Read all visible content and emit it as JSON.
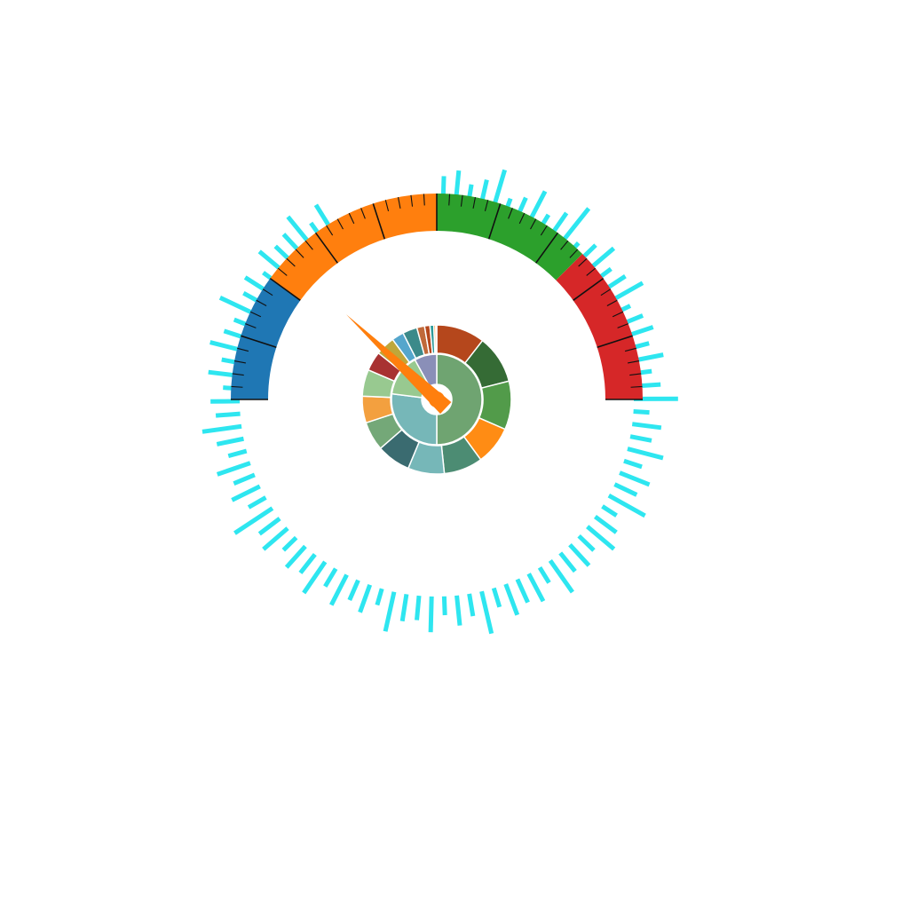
{
  "chart_data": [
    {
      "type": "gauge",
      "min": 0,
      "max": 100,
      "value": 24,
      "bands": [
        {
          "from": 0,
          "to": 20,
          "color": "#1f77b4"
        },
        {
          "from": 20,
          "to": 50,
          "color": "#ff7f0e"
        },
        {
          "from": 50,
          "to": 75,
          "color": "#2ca02c"
        },
        {
          "from": 75,
          "to": 100,
          "color": "#d62728"
        }
      ],
      "major_tick_every": 10,
      "minor_tick_every": 2,
      "needle_color": "#ff7f0e"
    },
    {
      "type": "radial-bar",
      "bar_color": "#2ee6f0",
      "start_angle_deg": 90,
      "end_angle_deg": -240,
      "values": [
        28,
        35,
        22,
        30,
        45,
        18,
        25,
        40,
        20,
        32,
        50,
        15,
        26,
        38,
        22,
        30,
        42,
        19,
        27,
        33,
        24,
        36,
        21,
        29,
        47,
        17,
        31,
        23,
        39,
        20,
        34,
        26,
        44,
        18,
        28,
        37,
        22,
        30,
        25,
        41,
        19,
        33,
        27,
        35,
        21,
        46,
        24,
        32,
        20,
        38,
        26,
        29,
        43,
        18,
        31,
        23,
        36,
        22,
        40,
        25,
        30,
        19,
        34,
        27,
        48,
        21,
        33,
        24,
        37,
        20,
        29,
        42,
        26,
        31,
        18,
        35,
        23,
        39,
        28,
        22,
        45,
        25,
        32,
        19,
        36,
        27,
        30,
        41,
        21,
        34
      ]
    },
    {
      "type": "sunburst",
      "inner": [
        {
          "value": 50,
          "color": "#6fa471"
        },
        {
          "value": 27,
          "color": "#76b7b8"
        },
        {
          "value": 15,
          "color": "#98c990"
        },
        {
          "value": 8,
          "color": "#8a8fb8"
        }
      ],
      "outer": [
        {
          "value": 10,
          "color": "#b5471c"
        },
        {
          "value": 10,
          "color": "#356b35"
        },
        {
          "value": 10,
          "color": "#529b4a"
        },
        {
          "value": 8,
          "color": "#ff8c14"
        },
        {
          "value": 8,
          "color": "#4c8c73"
        },
        {
          "value": 7.5,
          "color": "#76b7b8"
        },
        {
          "value": 7,
          "color": "#3a6b70"
        },
        {
          "value": 6,
          "color": "#74a878"
        },
        {
          "value": 5.5,
          "color": "#f3a03f"
        },
        {
          "value": 5.5,
          "color": "#98c990"
        },
        {
          "value": 4,
          "color": "#a83232"
        },
        {
          "value": 4,
          "color": "#bfa73a"
        },
        {
          "value": 2.5,
          "color": "#55a6cc"
        },
        {
          "value": 3,
          "color": "#3c8a8a"
        },
        {
          "value": 1.6,
          "color": "#c0693a"
        },
        {
          "value": 1.1,
          "color": "#b5471c"
        },
        {
          "value": 0.8,
          "color": "#2e9a9a"
        },
        {
          "value": 0.4,
          "color": "#ff8c14"
        },
        {
          "value": 0.2,
          "color": "#6fa471"
        }
      ]
    }
  ]
}
